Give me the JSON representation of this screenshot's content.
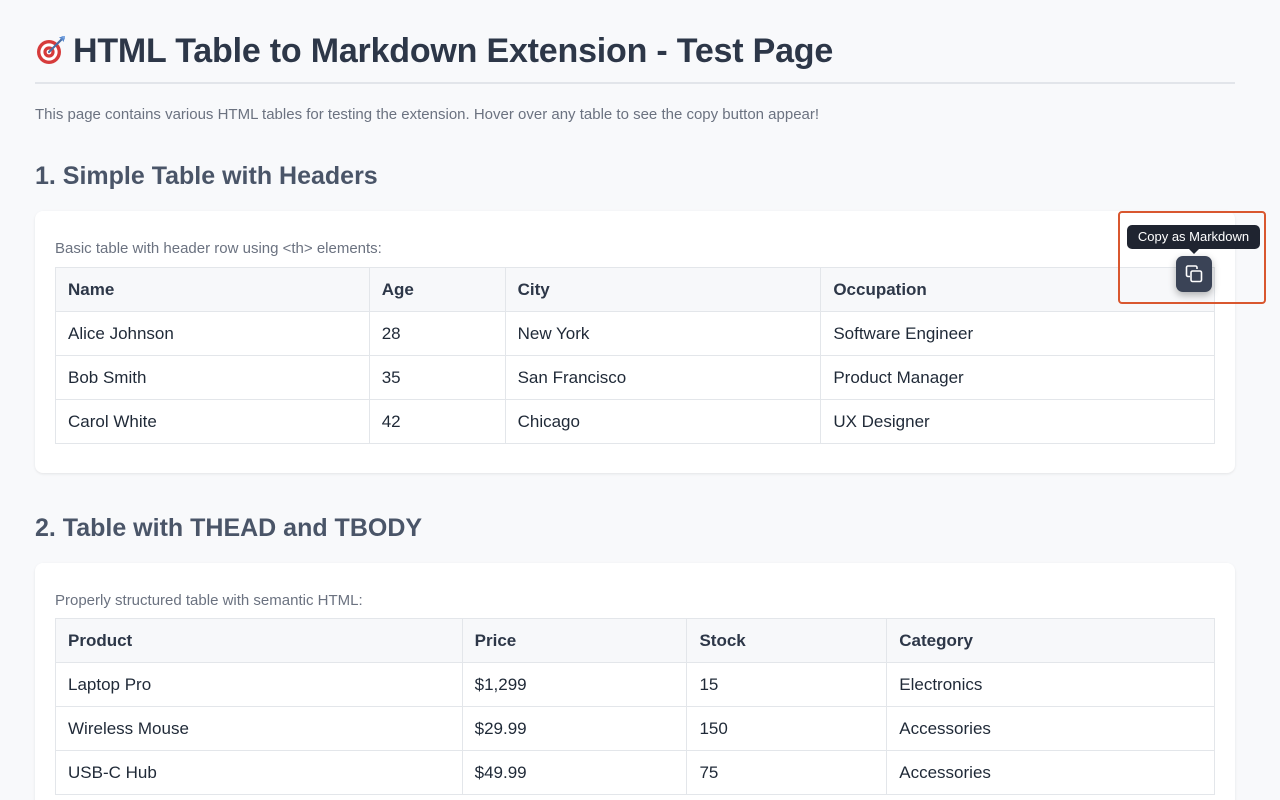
{
  "page": {
    "title": "HTML Table to Markdown Extension - Test Page",
    "title_icon": "target-dart-emoji",
    "intro": "This page contains various HTML tables for testing the extension. Hover over any table to see the copy button appear!"
  },
  "sections": [
    {
      "heading": "1. Simple Table with Headers",
      "description": "Basic table with header row using <th> elements:",
      "headers": [
        "Name",
        "Age",
        "City",
        "Occupation"
      ],
      "rows": [
        [
          "Alice Johnson",
          "28",
          "New York",
          "Software Engineer"
        ],
        [
          "Bob Smith",
          "35",
          "San Francisco",
          "Product Manager"
        ],
        [
          "Carol White",
          "42",
          "Chicago",
          "UX Designer"
        ]
      ]
    },
    {
      "heading": "2. Table with THEAD and TBODY",
      "description": "Properly structured table with semantic HTML:",
      "headers": [
        "Product",
        "Price",
        "Stock",
        "Category"
      ],
      "rows": [
        [
          "Laptop Pro",
          "$1,299",
          "15",
          "Electronics"
        ],
        [
          "Wireless Mouse",
          "$29.99",
          "150",
          "Accessories"
        ],
        [
          "USB-C Hub",
          "$49.99",
          "75",
          "Accessories"
        ]
      ]
    }
  ],
  "copy_button": {
    "tooltip": "Copy as Markdown",
    "icon": "copy-icon"
  },
  "colors": {
    "highlight_border": "#d9572f",
    "tooltip_bg": "#1f2430",
    "button_bg": "#3a4356",
    "page_bg": "#f8f9fb"
  }
}
